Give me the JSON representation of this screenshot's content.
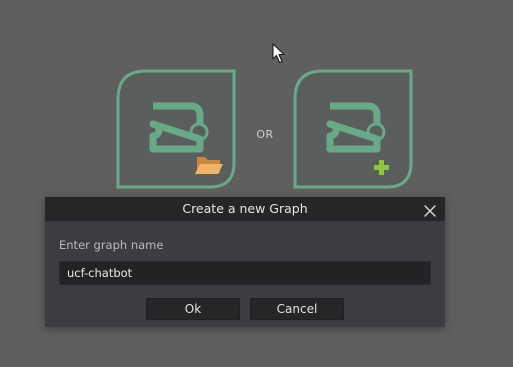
{
  "choices": {
    "separator_label": "OR",
    "open_icon": "open-graph-folder-icon",
    "new_icon": "new-graph-plus-icon"
  },
  "dialog": {
    "title": "Create a new Graph",
    "close_icon": "close-icon",
    "field_label": "Enter graph name",
    "field_value": "ucf-chatbot",
    "ok_label": "Ok",
    "cancel_label": "Cancel"
  },
  "colors": {
    "background": "#5f5f5f",
    "tile_border": "#6aa88a",
    "tile_fill": "#5a5f5d",
    "folder": "#e8a55f",
    "plus": "#8dc63f",
    "dialog_body": "#3b3d40",
    "dialog_titlebar": "#252627"
  }
}
